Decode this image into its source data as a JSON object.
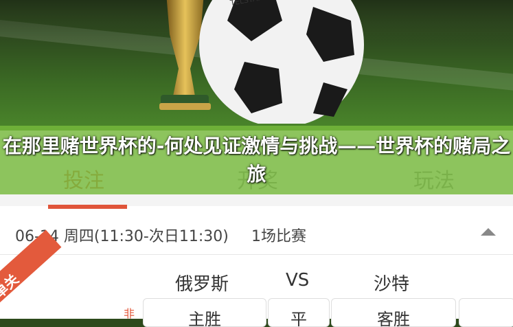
{
  "article": {
    "title": "在那里赌世界杯的-何处见证激情与挑战——世界杯的赌局之旅"
  },
  "hero_image": {
    "ball_brand": "TELSTAR",
    "accent_color": "#76ba3c"
  },
  "app": {
    "tabs": [
      {
        "label": "投注"
      },
      {
        "label": "开奖"
      },
      {
        "label": "玩法"
      }
    ],
    "active_tab": 0,
    "accent": "#e0553a",
    "schedule": {
      "date_range": "06-14 周四(11:30-次日11:30)",
      "match_count": "1场比赛"
    },
    "match": {
      "corner_tag": "单关",
      "home_team": "俄罗斯",
      "vs_label": "VS",
      "away_team": "沙特",
      "side_label": "非",
      "options": [
        {
          "label": "主胜"
        },
        {
          "label": "平"
        },
        {
          "label": "客胜"
        },
        {
          "label": ""
        }
      ]
    }
  }
}
